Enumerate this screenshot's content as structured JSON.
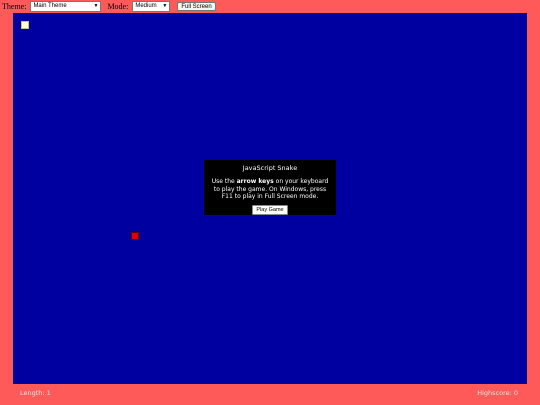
{
  "toolbar": {
    "theme_label": "Theme:",
    "theme_value": "Main Theme",
    "mode_label": "Mode:",
    "mode_value": "Medium",
    "fullscreen_label": "Full Screen"
  },
  "dialog": {
    "title": "JavaScript Snake",
    "msg_pre": "Use the ",
    "msg_bold": "arrow keys",
    "msg_post": " on your keyboard to play the game. On Windows, press F11 to play in Full Screen mode.",
    "play_label": "Play Game"
  },
  "status": {
    "length": "Length: 1",
    "highscore": "Highscore: 0"
  },
  "colors": {
    "page_bg": "#FF5A5A",
    "board_bg": "#0000A0",
    "snake": "#E00000",
    "food": "#FFFFCC"
  }
}
